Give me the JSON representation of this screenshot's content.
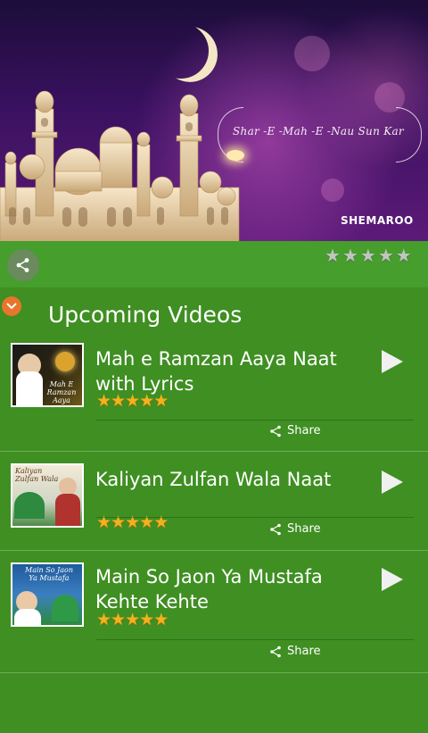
{
  "banner": {
    "title": "Shar -E -Mah -E -Nau Sun Kar",
    "brand": "SHEMAROO"
  },
  "toolbar": {
    "share_icon": "share-icon",
    "rating_stars": 5,
    "rating_color": "#bfc6bd"
  },
  "section": {
    "title": "Upcoming Videos",
    "icon": "chevron-down-icon",
    "icon_color": "#e8752c"
  },
  "videos": [
    {
      "title": "Mah e Ramzan Aaya Naat with Lyrics",
      "thumb_caption": "Mah E Ramzan Aaya",
      "stars": 5,
      "share_label": "Share"
    },
    {
      "title": "Kaliyan Zulfan Wala Naat",
      "thumb_caption": "Kaliyan Zulfan Wala",
      "stars": 5,
      "share_label": "Share"
    },
    {
      "title": "Main So Jaon Ya Mustafa Kehte Kehte",
      "thumb_caption": "Main So Jaon Ya Mustafa",
      "stars": 5,
      "share_label": "Share"
    }
  ],
  "colors": {
    "background": "#3f8f22",
    "star_gold": "#f2b21f",
    "text": "#ffffff"
  }
}
